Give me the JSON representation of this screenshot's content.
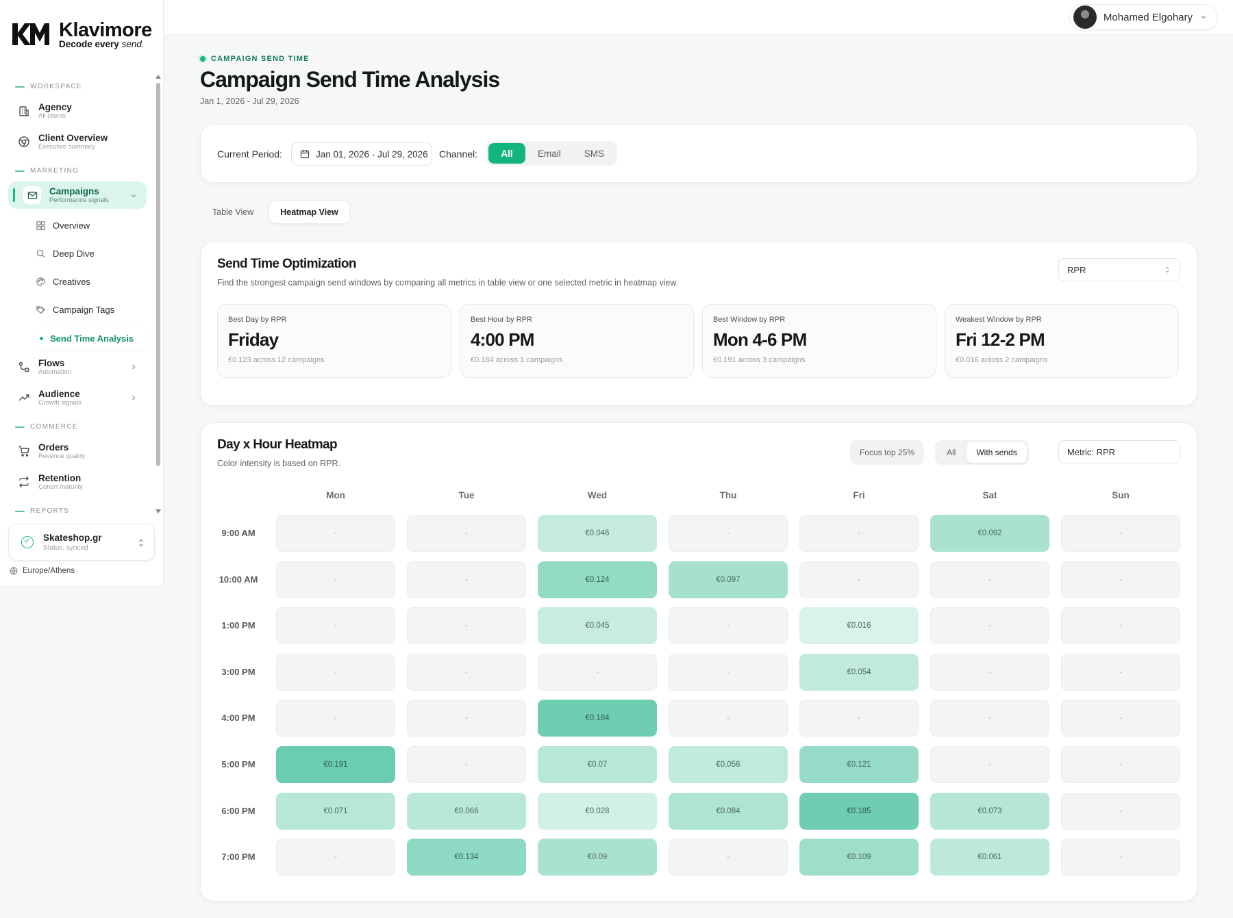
{
  "brand": {
    "name": "Klavimore",
    "tagline_bold": "Decode every",
    "tagline_italic": "send."
  },
  "user": {
    "name": "Mohamed Elgohary"
  },
  "sidebar": {
    "sections": {
      "workspace": "WORKSPACE",
      "marketing": "MARKETING",
      "commerce": "COMMERCE",
      "reports": "REPORTS"
    },
    "agency": {
      "title": "Agency",
      "subtitle": "All clients"
    },
    "client_overview": {
      "title": "Client Overview",
      "subtitle": "Executive summary"
    },
    "campaigns": {
      "title": "Campaigns",
      "subtitle": "Performance signals"
    },
    "campaign_sub": [
      "Overview",
      "Deep Dive",
      "Creatives",
      "Campaign Tags",
      "Send Time Analysis"
    ],
    "flows": {
      "title": "Flows",
      "subtitle": "Automation"
    },
    "audience": {
      "title": "Audience",
      "subtitle": "Growth signals"
    },
    "orders": {
      "title": "Orders",
      "subtitle": "Revenue quality"
    },
    "retention": {
      "title": "Retention",
      "subtitle": "Cohort maturity"
    },
    "store": {
      "name": "Skateshop.gr",
      "status": "Status: synced"
    },
    "timezone": "Europe/Athens"
  },
  "page": {
    "eyebrow": "CAMPAIGN SEND TIME",
    "title": "Campaign Send Time Analysis",
    "dates": "Jan 1, 2026 - Jul 29, 2026"
  },
  "filters": {
    "period_label": "Current Period:",
    "period_value": "Jan 01, 2026 - Jul 29, 2026",
    "channel_label": "Channel:",
    "channels": [
      "All",
      "Email",
      "SMS"
    ],
    "channel_selected": "All"
  },
  "view_tabs": {
    "table": "Table View",
    "heatmap": "Heatmap View",
    "selected": "Heatmap View"
  },
  "optimization": {
    "title": "Send Time Optimization",
    "description": "Find the strongest campaign send windows by comparing all metrics in table view or one selected metric in heatmap view.",
    "metric": "RPR",
    "stats": [
      {
        "label": "Best Day by RPR",
        "value": "Friday",
        "note": "€0.123 across 12 campaigns"
      },
      {
        "label": "Best Hour by RPR",
        "value": "4:00 PM",
        "note": "€0.184 across 1 campaigns"
      },
      {
        "label": "Best Window by RPR",
        "value": "Mon 4-6 PM",
        "note": "€0.191 across 3 campaigns"
      },
      {
        "label": "Weakest Window by RPR",
        "value": "Fri 12-2 PM",
        "note": "€0.016 across 2 campaigns"
      }
    ]
  },
  "heatmap": {
    "title": "Day x Hour Heatmap",
    "description": "Color intensity is based on RPR.",
    "focus_label": "Focus top 25%",
    "filter_options": [
      "All",
      "With sends"
    ],
    "filter_selected": "With sends",
    "metric_label": "Metric: RPR",
    "days": [
      "Mon",
      "Tue",
      "Wed",
      "Thu",
      "Fri",
      "Sat",
      "Sun"
    ],
    "hours": [
      "9:00 AM",
      "10:00 AM",
      "1:00 PM",
      "3:00 PM",
      "4:00 PM",
      "5:00 PM",
      "6:00 PM",
      "7:00 PM"
    ],
    "empty_symbol": "-",
    "values": [
      [
        null,
        null,
        0.046,
        null,
        null,
        0.092,
        null
      ],
      [
        null,
        null,
        0.124,
        0.097,
        null,
        null,
        null
      ],
      [
        null,
        null,
        0.045,
        null,
        0.016,
        null,
        null
      ],
      [
        null,
        null,
        null,
        null,
        0.054,
        null,
        null
      ],
      [
        null,
        null,
        0.184,
        null,
        null,
        null,
        null
      ],
      [
        0.191,
        null,
        0.07,
        0.056,
        0.121,
        null,
        null
      ],
      [
        0.071,
        0.066,
        0.028,
        0.084,
        0.185,
        0.073,
        null
      ],
      [
        null,
        0.134,
        0.09,
        null,
        0.109,
        0.061,
        null
      ]
    ],
    "labels": [
      [
        "-",
        "-",
        "€0.046",
        "-",
        "-",
        "€0.092",
        "-"
      ],
      [
        "-",
        "-",
        "€0.124",
        "€0.097",
        "-",
        "-",
        "-"
      ],
      [
        "-",
        "-",
        "€0.045",
        "-",
        "€0.016",
        "-",
        "-"
      ],
      [
        "-",
        "-",
        "-",
        "-",
        "€0.054",
        "-",
        "-"
      ],
      [
        "-",
        "-",
        "€0.184",
        "-",
        "-",
        "-",
        "-"
      ],
      [
        "€0.191",
        "-",
        "€0.07",
        "€0.056",
        "€0.121",
        "-",
        "-"
      ],
      [
        "€0.071",
        "€0.066",
        "€0.028",
        "€0.084",
        "€0.185",
        "€0.073",
        "-"
      ],
      [
        "-",
        "€0.134",
        "€0.09",
        "-",
        "€0.109",
        "€0.061",
        "-"
      ]
    ]
  },
  "colors": {
    "accent": "#12b57b",
    "heat_low": "#e6f7f1",
    "heat_high": "#6ccdb0"
  }
}
